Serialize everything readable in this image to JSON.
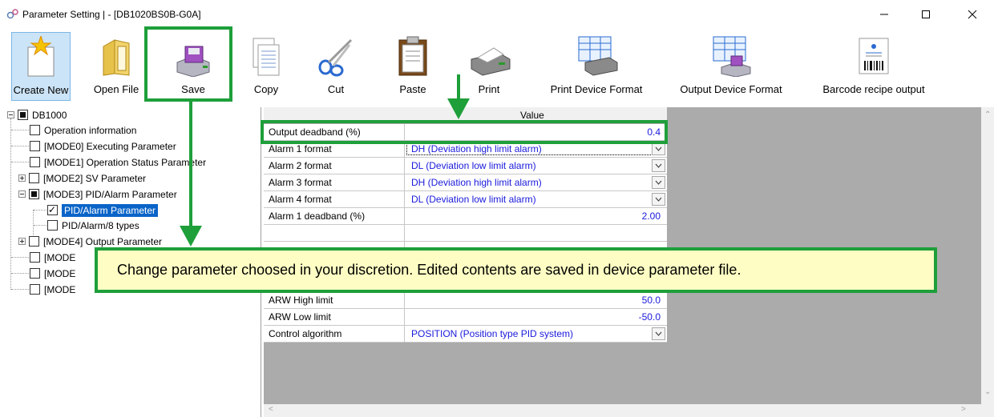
{
  "window": {
    "title": "Parameter Setting |  - [DB1020BS0B-G0A]",
    "app_icon": "gear-cluster-icon",
    "controls": [
      "minimize-icon",
      "maximize-icon",
      "close-icon"
    ]
  },
  "toolbar": {
    "buttons": [
      {
        "label": "Create New",
        "icon": "new-file-star-icon",
        "active": true
      },
      {
        "label": "Open File",
        "icon": "open-folder-icon"
      },
      {
        "label": "Save",
        "icon": "floppy-disk-icon",
        "highlighted": true
      },
      {
        "label": "Copy",
        "icon": "copy-pages-icon"
      },
      {
        "label": "Cut",
        "icon": "scissors-icon"
      },
      {
        "label": "Paste",
        "icon": "clipboard-icon"
      },
      {
        "label": "Print",
        "icon": "printer-icon"
      },
      {
        "label": "Print Device Format",
        "icon": "print-device-format-icon"
      },
      {
        "label": "Output Device Format",
        "icon": "output-device-format-icon"
      },
      {
        "label": "Barcode recipe output",
        "icon": "barcode-icon"
      }
    ]
  },
  "tree": {
    "root": {
      "label": "DB1000"
    },
    "items": [
      {
        "label": "Operation information"
      },
      {
        "label": "[MODE0] Executing Parameter"
      },
      {
        "label": "[MODE1] Operation Status Parameter"
      },
      {
        "label": "[MODE2] SV Parameter"
      },
      {
        "label": "[MODE3] PID/Alarm Parameter"
      },
      {
        "label": "PID/Alarm Parameter"
      },
      {
        "label": "PID/Alarm/8 types"
      },
      {
        "label": "[MODE4] Output Parameter"
      },
      {
        "label": "[MODE"
      },
      {
        "label": "[MODE"
      },
      {
        "label": "[MODE"
      }
    ]
  },
  "grid": {
    "column_header": "Value",
    "rows": [
      {
        "name": "Output deadband (%)",
        "value": "0.4"
      },
      {
        "name": "Alarm 1 format",
        "value": "DH (Deviation high limit alarm)"
      },
      {
        "name": "Alarm 2 format",
        "value": "DL (Deviation low limit alarm)"
      },
      {
        "name": "Alarm 3 format",
        "value": "DH (Deviation high limit alarm)"
      },
      {
        "name": "Alarm 4 format",
        "value": "DL (Deviation low limit alarm)"
      },
      {
        "name": "Alarm 1 deadband (%)",
        "value": "2.00"
      },
      {
        "name": "ARW High limit",
        "value": "50.0"
      },
      {
        "name": "ARW Low limit",
        "value": "-50.0"
      },
      {
        "name": "Control algorithm",
        "value": "POSITION (Position type PID system)"
      }
    ]
  },
  "callout": {
    "text": "Change parameter choosed in your discretion. Edited contents are saved in device parameter file."
  },
  "colors": {
    "highlight_green": "#1e9f3a",
    "callout_bg": "#fefec4",
    "value_blue": "#1a1adc",
    "selection_blue": "#0a64c8",
    "grid_bg": "#ababab"
  }
}
